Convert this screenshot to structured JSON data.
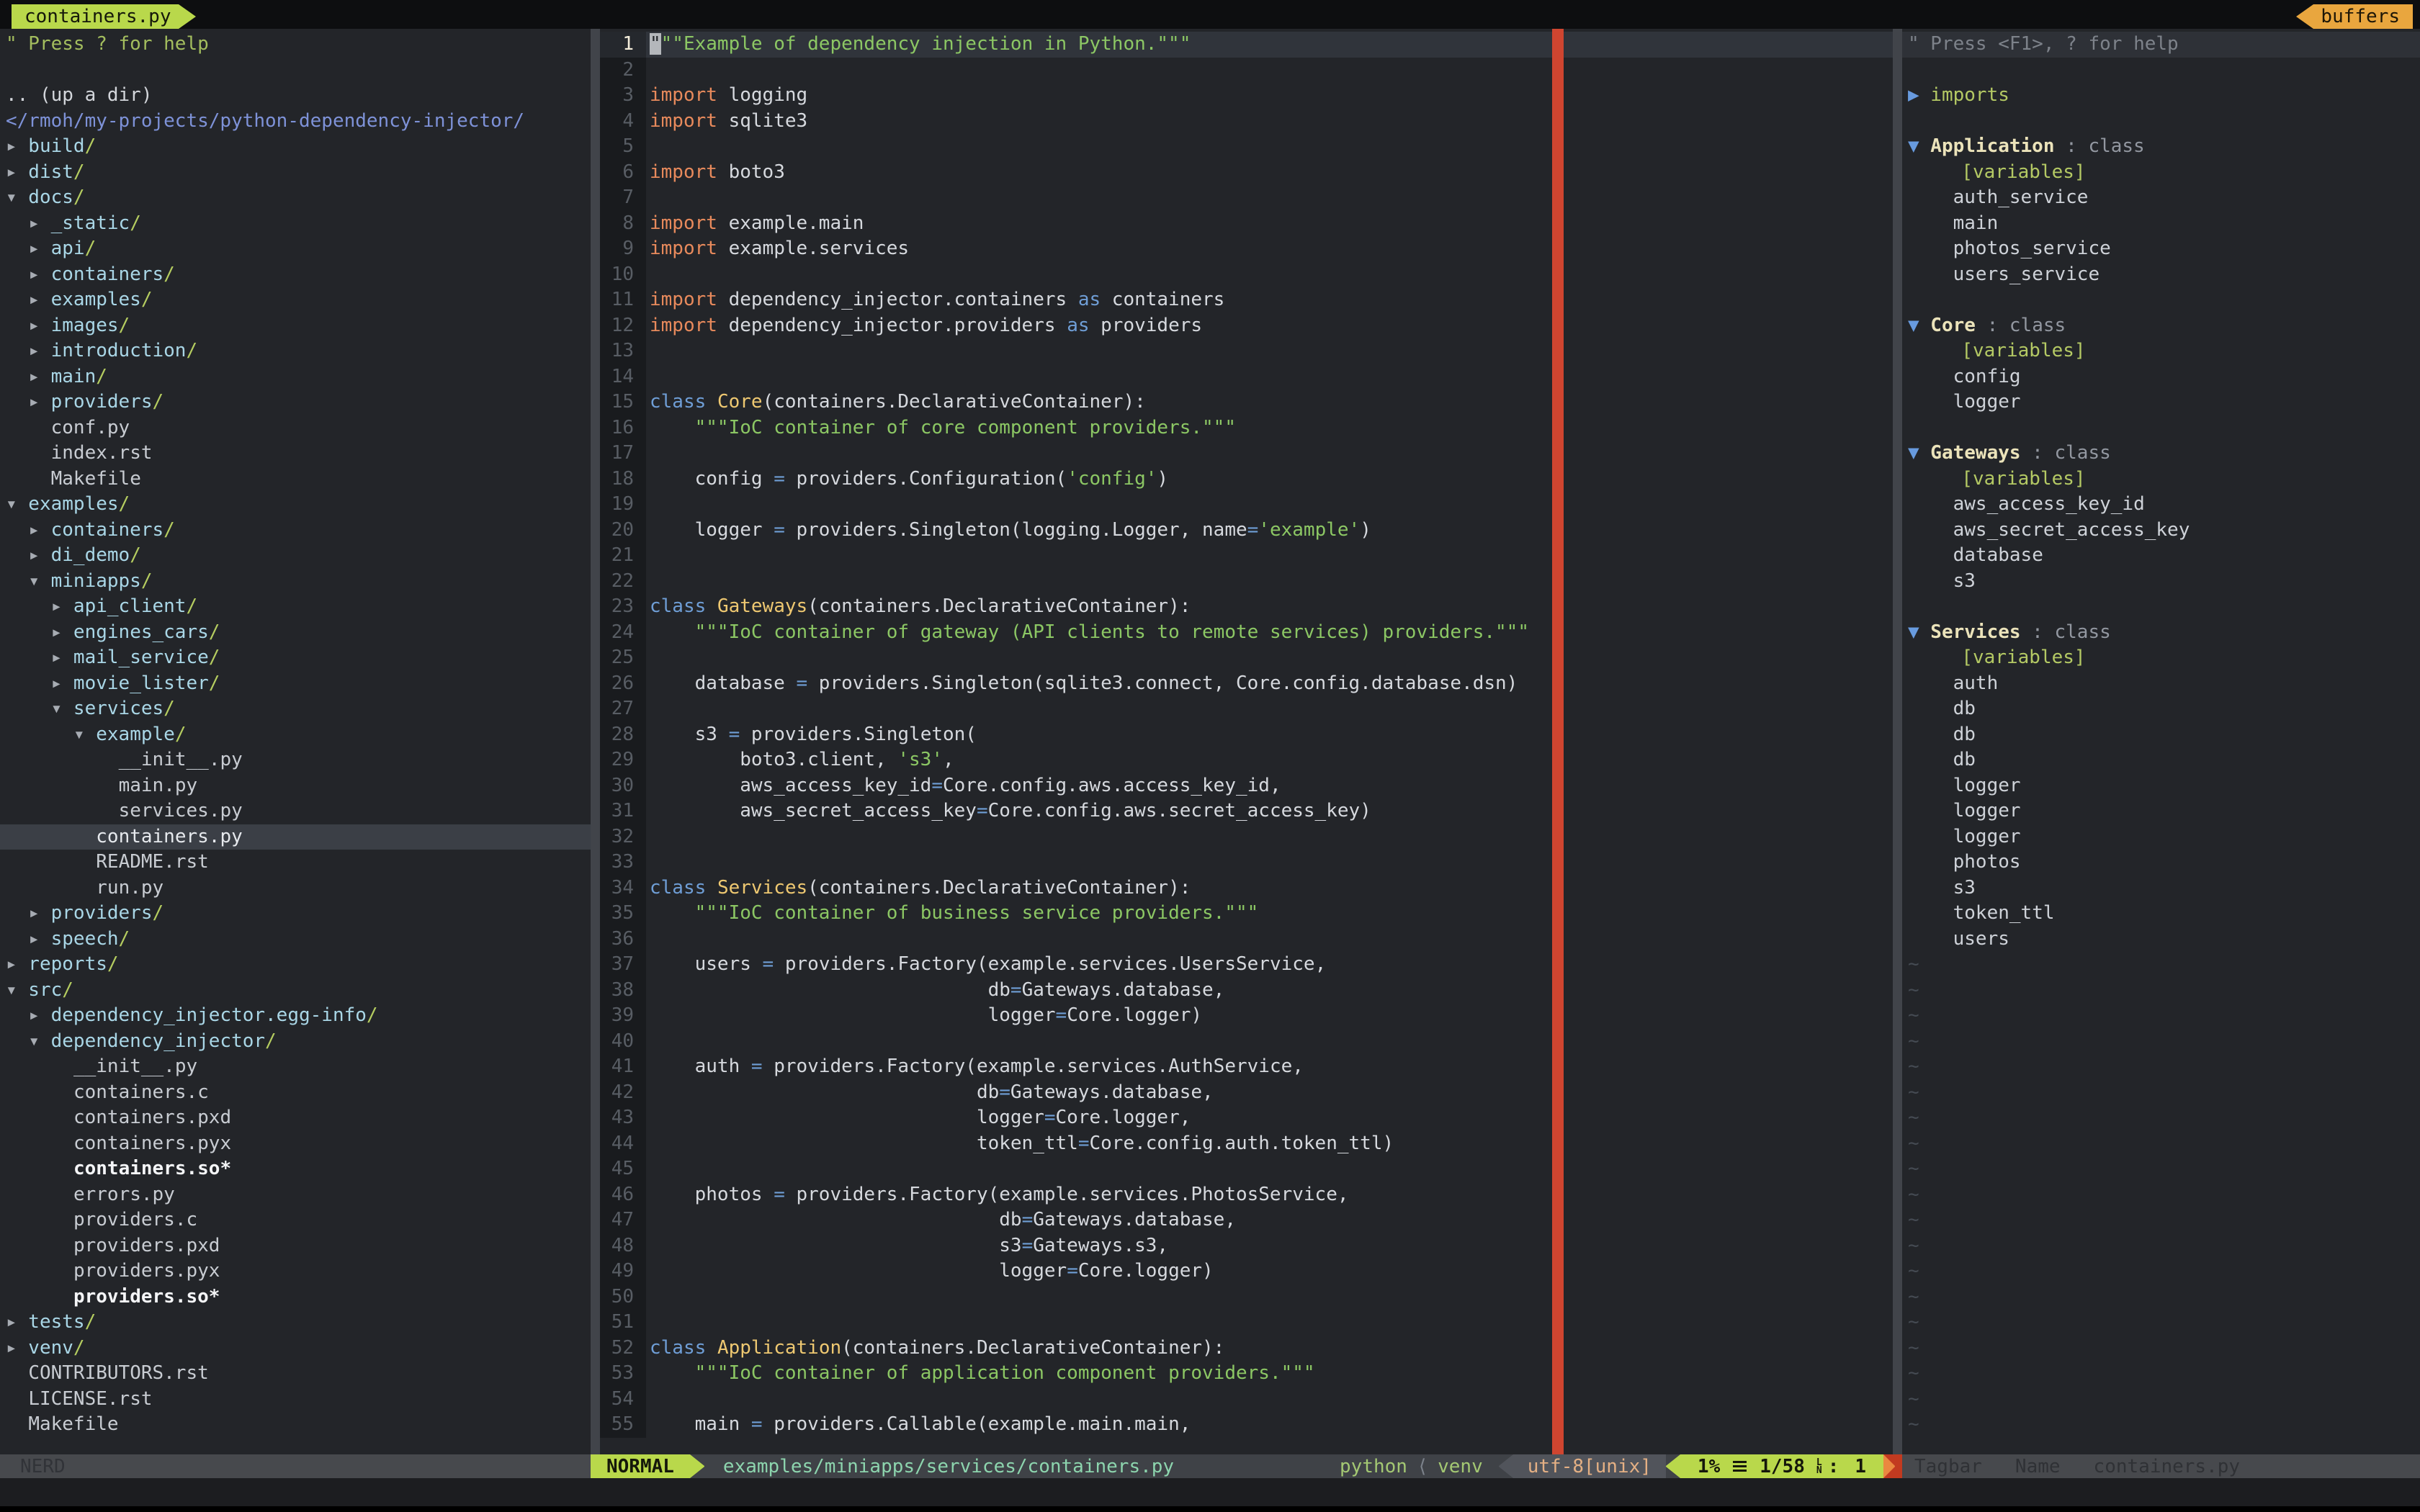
{
  "tabline": {
    "left_tab": "containers.py",
    "right_tab": "buffers"
  },
  "colors": {
    "accent_green": "#b9d84b",
    "accent_orange": "#e9a63e",
    "colorcolumn_red": "#cf4530",
    "string_green": "#8cc764",
    "keyword_orange": "#e88a5c",
    "keyword_blue": "#6f9ed6",
    "classname_yellow": "#eec871",
    "dir_cyan": "#a9d6e6",
    "path_blue": "#7e92d8"
  },
  "nerdtree": {
    "status": "NERD",
    "rows": [
      {
        "t": "help",
        "text": "\" Press ? for help"
      },
      {
        "t": "blank"
      },
      {
        "t": "updir",
        "text": ".. (up a dir)"
      },
      {
        "t": "path",
        "text": "</rmoh/my-projects/python-dependency-injector/"
      },
      {
        "t": "dir",
        "c": 0,
        "arrow": "closed",
        "name": "build"
      },
      {
        "t": "dir",
        "c": 0,
        "arrow": "closed",
        "name": "dist"
      },
      {
        "t": "dir",
        "c": 0,
        "arrow": "open",
        "name": "docs"
      },
      {
        "t": "dir",
        "c": 2,
        "arrow": "closed",
        "name": "_static"
      },
      {
        "t": "dir",
        "c": 2,
        "arrow": "closed",
        "name": "api"
      },
      {
        "t": "dir",
        "c": 2,
        "arrow": "closed",
        "name": "containers"
      },
      {
        "t": "dir",
        "c": 2,
        "arrow": "closed",
        "name": "examples"
      },
      {
        "t": "dir",
        "c": 2,
        "arrow": "closed",
        "name": "images"
      },
      {
        "t": "dir",
        "c": 2,
        "arrow": "closed",
        "name": "introduction"
      },
      {
        "t": "dir",
        "c": 2,
        "arrow": "closed",
        "name": "main"
      },
      {
        "t": "dir",
        "c": 2,
        "arrow": "closed",
        "name": "providers"
      },
      {
        "t": "file",
        "c": 4,
        "name": "conf.py"
      },
      {
        "t": "file",
        "c": 4,
        "name": "index.rst"
      },
      {
        "t": "file",
        "c": 4,
        "name": "Makefile"
      },
      {
        "t": "dir",
        "c": 0,
        "arrow": "open",
        "name": "examples"
      },
      {
        "t": "dir",
        "c": 2,
        "arrow": "closed",
        "name": "containers"
      },
      {
        "t": "dir",
        "c": 2,
        "arrow": "closed",
        "name": "di_demo"
      },
      {
        "t": "dir",
        "c": 2,
        "arrow": "open",
        "name": "miniapps"
      },
      {
        "t": "dir",
        "c": 4,
        "arrow": "closed",
        "name": "api_client"
      },
      {
        "t": "dir",
        "c": 4,
        "arrow": "closed",
        "name": "engines_cars"
      },
      {
        "t": "dir",
        "c": 4,
        "arrow": "closed",
        "name": "mail_service"
      },
      {
        "t": "dir",
        "c": 4,
        "arrow": "closed",
        "name": "movie_lister"
      },
      {
        "t": "dir",
        "c": 4,
        "arrow": "open",
        "name": "services"
      },
      {
        "t": "dir",
        "c": 6,
        "arrow": "open",
        "name": "example"
      },
      {
        "t": "file",
        "c": 10,
        "name": "__init__.py"
      },
      {
        "t": "file",
        "c": 10,
        "name": "main.py"
      },
      {
        "t": "file",
        "c": 10,
        "name": "services.py"
      },
      {
        "t": "file",
        "c": 8,
        "name": "containers.py",
        "selected": true
      },
      {
        "t": "file",
        "c": 8,
        "name": "README.rst"
      },
      {
        "t": "file",
        "c": 8,
        "name": "run.py"
      },
      {
        "t": "dir",
        "c": 2,
        "arrow": "closed",
        "name": "providers"
      },
      {
        "t": "dir",
        "c": 2,
        "arrow": "closed",
        "name": "speech"
      },
      {
        "t": "dir",
        "c": 0,
        "arrow": "closed",
        "name": "reports"
      },
      {
        "t": "dir",
        "c": 0,
        "arrow": "open",
        "name": "src"
      },
      {
        "t": "dir",
        "c": 2,
        "arrow": "closed",
        "name": "dependency_injector.egg-info"
      },
      {
        "t": "dir",
        "c": 2,
        "arrow": "open",
        "name": "dependency_injector"
      },
      {
        "t": "file",
        "c": 6,
        "name": "__init__.py"
      },
      {
        "t": "file",
        "c": 6,
        "name": "containers.c"
      },
      {
        "t": "file",
        "c": 6,
        "name": "containers.pxd"
      },
      {
        "t": "file",
        "c": 6,
        "name": "containers.pyx"
      },
      {
        "t": "exec",
        "c": 6,
        "name": "containers.so*"
      },
      {
        "t": "file",
        "c": 6,
        "name": "errors.py"
      },
      {
        "t": "file",
        "c": 6,
        "name": "providers.c"
      },
      {
        "t": "file",
        "c": 6,
        "name": "providers.pxd"
      },
      {
        "t": "file",
        "c": 6,
        "name": "providers.pyx"
      },
      {
        "t": "exec",
        "c": 6,
        "name": "providers.so*"
      },
      {
        "t": "dir",
        "c": 0,
        "arrow": "closed",
        "name": "tests"
      },
      {
        "t": "dir",
        "c": 0,
        "arrow": "closed",
        "name": "venv"
      },
      {
        "t": "file",
        "c": 2,
        "name": "CONTRIBUTORS.rst"
      },
      {
        "t": "file",
        "c": 2,
        "name": "LICENSE.rst"
      },
      {
        "t": "file",
        "c": 2,
        "name": "Makefile"
      }
    ]
  },
  "editor": {
    "lines": [
      {
        "cursorline": true,
        "segs": [
          [
            "cur",
            "\""
          ],
          [
            "str",
            "\"\"Example of dependency injection in Python.\"\"\""
          ]
        ]
      },
      {
        "segs": []
      },
      {
        "segs": [
          [
            "kw",
            "import"
          ],
          [
            "txt",
            " logging"
          ]
        ]
      },
      {
        "segs": [
          [
            "kw",
            "import"
          ],
          [
            "txt",
            " sqlite3"
          ]
        ]
      },
      {
        "segs": []
      },
      {
        "segs": [
          [
            "kw",
            "import"
          ],
          [
            "txt",
            " boto3"
          ]
        ]
      },
      {
        "segs": []
      },
      {
        "segs": [
          [
            "kw",
            "import"
          ],
          [
            "txt",
            " example.main"
          ]
        ]
      },
      {
        "segs": [
          [
            "kw",
            "import"
          ],
          [
            "txt",
            " example.services"
          ]
        ]
      },
      {
        "segs": []
      },
      {
        "segs": [
          [
            "kw",
            "import"
          ],
          [
            "txt",
            " dependency_injector.containers "
          ],
          [
            "blue",
            "as"
          ],
          [
            "txt",
            " containers"
          ]
        ]
      },
      {
        "segs": [
          [
            "kw",
            "import"
          ],
          [
            "txt",
            " dependency_injector.providers "
          ],
          [
            "blue",
            "as"
          ],
          [
            "txt",
            " providers"
          ]
        ]
      },
      {
        "segs": []
      },
      {
        "segs": []
      },
      {
        "segs": [
          [
            "blue",
            "class"
          ],
          [
            "txt",
            " "
          ],
          [
            "cls",
            "Core"
          ],
          [
            "txt",
            "(containers.DeclarativeContainer):"
          ]
        ]
      },
      {
        "segs": [
          [
            "txt",
            "    "
          ],
          [
            "str",
            "\"\"\"IoC container of core component providers.\"\"\""
          ]
        ]
      },
      {
        "segs": []
      },
      {
        "segs": [
          [
            "txt",
            "    config "
          ],
          [
            "blue",
            "="
          ],
          [
            "txt",
            " providers.Configuration("
          ],
          [
            "str",
            "'config'"
          ],
          [
            "txt",
            ")"
          ]
        ]
      },
      {
        "segs": []
      },
      {
        "segs": [
          [
            "txt",
            "    logger "
          ],
          [
            "blue",
            "="
          ],
          [
            "txt",
            " providers.Singleton(logging.Logger, name"
          ],
          [
            "blue",
            "="
          ],
          [
            "str",
            "'example'"
          ],
          [
            "txt",
            ")"
          ]
        ]
      },
      {
        "segs": []
      },
      {
        "segs": []
      },
      {
        "segs": [
          [
            "blue",
            "class"
          ],
          [
            "txt",
            " "
          ],
          [
            "cls",
            "Gateways"
          ],
          [
            "txt",
            "(containers.DeclarativeContainer):"
          ]
        ]
      },
      {
        "segs": [
          [
            "txt",
            "    "
          ],
          [
            "str",
            "\"\"\"IoC container of gateway (API clients to remote services) providers.\"\"\""
          ]
        ]
      },
      {
        "segs": []
      },
      {
        "segs": [
          [
            "txt",
            "    database "
          ],
          [
            "blue",
            "="
          ],
          [
            "txt",
            " providers.Singleton(sqlite3.connect, Core.config.database.dsn)"
          ]
        ]
      },
      {
        "segs": []
      },
      {
        "segs": [
          [
            "txt",
            "    s3 "
          ],
          [
            "blue",
            "="
          ],
          [
            "txt",
            " providers.Singleton("
          ]
        ]
      },
      {
        "segs": [
          [
            "txt",
            "        boto3.client, "
          ],
          [
            "str",
            "'s3'"
          ],
          [
            "txt",
            ","
          ]
        ]
      },
      {
        "segs": [
          [
            "txt",
            "        aws_access_key_id"
          ],
          [
            "blue",
            "="
          ],
          [
            "txt",
            "Core.config.aws.access_key_id,"
          ]
        ]
      },
      {
        "segs": [
          [
            "txt",
            "        aws_secret_access_key"
          ],
          [
            "blue",
            "="
          ],
          [
            "txt",
            "Core.config.aws.secret_access_key)"
          ]
        ]
      },
      {
        "segs": []
      },
      {
        "segs": []
      },
      {
        "segs": [
          [
            "blue",
            "class"
          ],
          [
            "txt",
            " "
          ],
          [
            "cls",
            "Services"
          ],
          [
            "txt",
            "(containers.DeclarativeContainer):"
          ]
        ]
      },
      {
        "segs": [
          [
            "txt",
            "    "
          ],
          [
            "str",
            "\"\"\"IoC container of business service providers.\"\"\""
          ]
        ]
      },
      {
        "segs": []
      },
      {
        "segs": [
          [
            "txt",
            "    users "
          ],
          [
            "blue",
            "="
          ],
          [
            "txt",
            " providers.Factory(example.services.UsersService,"
          ]
        ]
      },
      {
        "segs": [
          [
            "txt",
            "                              db"
          ],
          [
            "blue",
            "="
          ],
          [
            "txt",
            "Gateways.database,"
          ]
        ]
      },
      {
        "segs": [
          [
            "txt",
            "                              logger"
          ],
          [
            "blue",
            "="
          ],
          [
            "txt",
            "Core.logger)"
          ]
        ]
      },
      {
        "segs": []
      },
      {
        "segs": [
          [
            "txt",
            "    auth "
          ],
          [
            "blue",
            "="
          ],
          [
            "txt",
            " providers.Factory(example.services.AuthService,"
          ]
        ]
      },
      {
        "segs": [
          [
            "txt",
            "                             db"
          ],
          [
            "blue",
            "="
          ],
          [
            "txt",
            "Gateways.database,"
          ]
        ]
      },
      {
        "segs": [
          [
            "txt",
            "                             logger"
          ],
          [
            "blue",
            "="
          ],
          [
            "txt",
            "Core.logger,"
          ]
        ]
      },
      {
        "segs": [
          [
            "txt",
            "                             token_ttl"
          ],
          [
            "blue",
            "="
          ],
          [
            "txt",
            "Core.config.auth.token_ttl)"
          ]
        ]
      },
      {
        "segs": []
      },
      {
        "segs": [
          [
            "txt",
            "    photos "
          ],
          [
            "blue",
            "="
          ],
          [
            "txt",
            " providers.Factory(example.services.PhotosService,"
          ]
        ]
      },
      {
        "segs": [
          [
            "txt",
            "                               db"
          ],
          [
            "blue",
            "="
          ],
          [
            "txt",
            "Gateways.database,"
          ]
        ]
      },
      {
        "segs": [
          [
            "txt",
            "                               s3"
          ],
          [
            "blue",
            "="
          ],
          [
            "txt",
            "Gateways.s3,"
          ]
        ]
      },
      {
        "segs": [
          [
            "txt",
            "                               logger"
          ],
          [
            "blue",
            "="
          ],
          [
            "txt",
            "Core.logger)"
          ]
        ]
      },
      {
        "segs": []
      },
      {
        "segs": []
      },
      {
        "segs": [
          [
            "blue",
            "class"
          ],
          [
            "txt",
            " "
          ],
          [
            "cls",
            "Application"
          ],
          [
            "txt",
            "(containers.DeclarativeContainer):"
          ]
        ]
      },
      {
        "segs": [
          [
            "txt",
            "    "
          ],
          [
            "str",
            "\"\"\"IoC container of application component providers.\"\"\""
          ]
        ]
      },
      {
        "segs": []
      },
      {
        "segs": [
          [
            "txt",
            "    main "
          ],
          [
            "blue",
            "="
          ],
          [
            "txt",
            " providers.Callable(example.main.main,"
          ]
        ]
      }
    ]
  },
  "tagbar": {
    "tilde_count": 19,
    "rows": [
      {
        "t": "help",
        "text": "\" Press <F1>, ? for help"
      },
      {
        "t": "blank"
      },
      {
        "t": "root",
        "name": "imports",
        "arrow": "closed"
      },
      {
        "t": "blank"
      },
      {
        "t": "class",
        "name": "Application",
        "kind": "class",
        "arrow": "open"
      },
      {
        "t": "kind",
        "name": "[variables]"
      },
      {
        "t": "member",
        "name": "auth_service"
      },
      {
        "t": "member",
        "name": "main"
      },
      {
        "t": "member",
        "name": "photos_service"
      },
      {
        "t": "member",
        "name": "users_service"
      },
      {
        "t": "blank"
      },
      {
        "t": "class",
        "name": "Core",
        "kind": "class",
        "arrow": "open"
      },
      {
        "t": "kind",
        "name": "[variables]"
      },
      {
        "t": "member",
        "name": "config"
      },
      {
        "t": "member",
        "name": "logger"
      },
      {
        "t": "blank"
      },
      {
        "t": "class",
        "name": "Gateways",
        "kind": "class",
        "arrow": "open"
      },
      {
        "t": "kind",
        "name": "[variables]"
      },
      {
        "t": "member",
        "name": "aws_access_key_id"
      },
      {
        "t": "member",
        "name": "aws_secret_access_key"
      },
      {
        "t": "member",
        "name": "database"
      },
      {
        "t": "member",
        "name": "s3"
      },
      {
        "t": "blank"
      },
      {
        "t": "class",
        "name": "Services",
        "kind": "class",
        "arrow": "open"
      },
      {
        "t": "kind",
        "name": "[variables]"
      },
      {
        "t": "member",
        "name": "auth"
      },
      {
        "t": "member",
        "name": "db"
      },
      {
        "t": "member",
        "name": "db"
      },
      {
        "t": "member",
        "name": "db"
      },
      {
        "t": "member",
        "name": "logger"
      },
      {
        "t": "member",
        "name": "logger"
      },
      {
        "t": "member",
        "name": "logger"
      },
      {
        "t": "member",
        "name": "photos"
      },
      {
        "t": "member",
        "name": "s3"
      },
      {
        "t": "member",
        "name": "token_ttl"
      },
      {
        "t": "member",
        "name": "users"
      }
    ],
    "status": {
      "plugin": "Tagbar",
      "sort": "Name",
      "file": "containers.py"
    }
  },
  "statusline": {
    "mode": "NORMAL",
    "path": "examples/miniapps/services/containers.py",
    "filetype": "python",
    "angle": "⟨",
    "venv": "venv",
    "encoding": "utf-8[unix]",
    "percent": "1%",
    "position": "1/58",
    "colon": ":",
    "column": "1"
  },
  "command_line": ""
}
